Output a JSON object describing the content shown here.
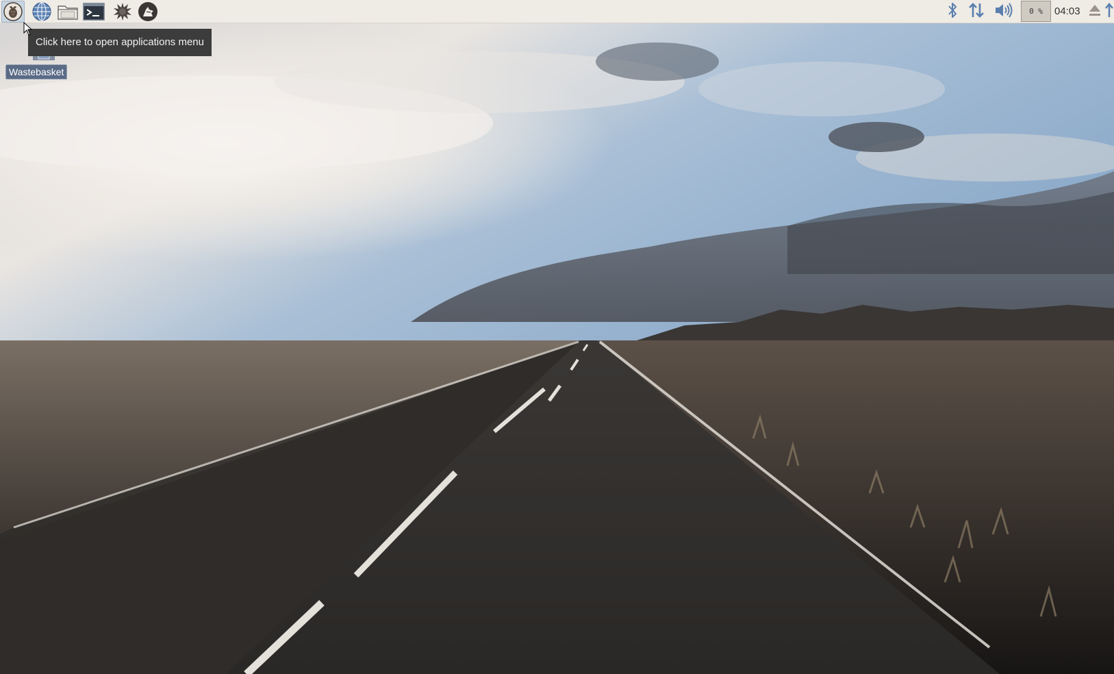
{
  "panel": {
    "launchers": [
      {
        "name": "applications-menu",
        "icon": "raspberry-icon"
      },
      {
        "name": "web-browser",
        "icon": "globe-icon"
      },
      {
        "name": "file-manager",
        "icon": "folder-icon"
      },
      {
        "name": "terminal",
        "icon": "terminal-icon"
      },
      {
        "name": "math-kernel",
        "icon": "starburst-icon"
      },
      {
        "name": "wolfram",
        "icon": "wolf-icon"
      }
    ],
    "tray": {
      "bluetooth_icon": "bluetooth-icon",
      "network_icon": "network-arrows-icon",
      "volume_icon": "speaker-icon",
      "cpu_usage": "0 %",
      "clock": "04:03",
      "eject_icon": "eject-icon"
    }
  },
  "tooltip": {
    "text": "Click here to open applications menu"
  },
  "desktop": {
    "icons": [
      {
        "label": "Wastebasket",
        "icon": "wastebasket-icon"
      }
    ]
  },
  "colors": {
    "panel_bg": "#efebe5",
    "tooltip_bg": "#3c3c3c",
    "selection_bg": "#5a6b86"
  }
}
